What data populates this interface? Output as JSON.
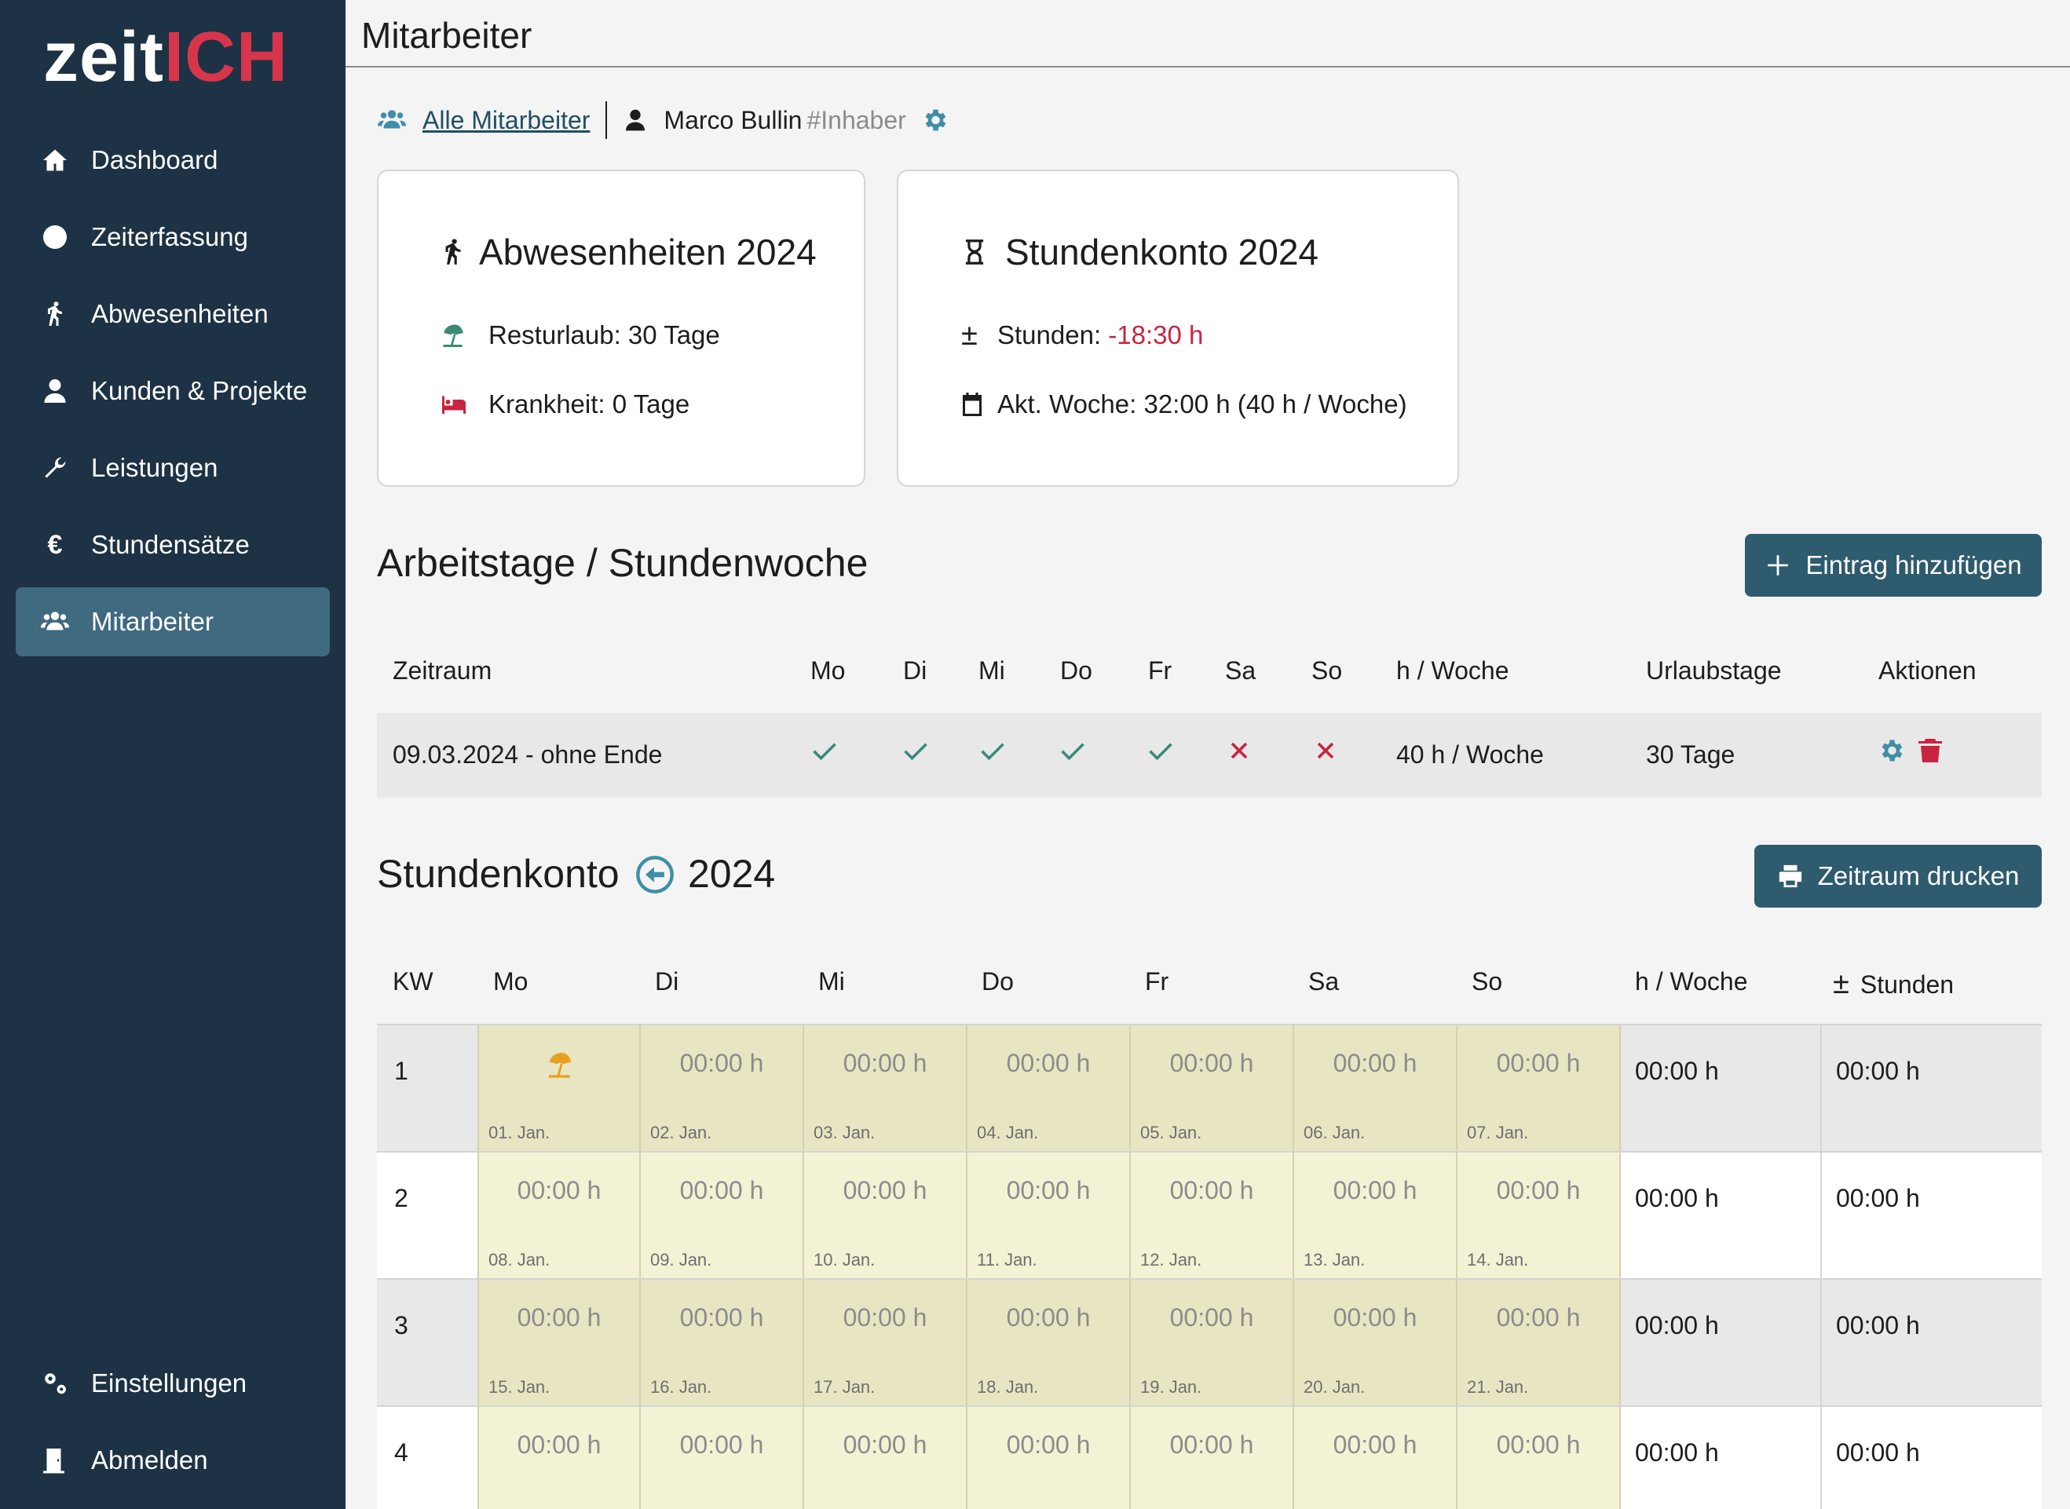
{
  "app": {
    "logo_left": "zeit",
    "logo_right": "ICH"
  },
  "sidebar": {
    "items": [
      {
        "label": "Dashboard",
        "icon": "home-icon"
      },
      {
        "label": "Zeiterfassung",
        "icon": "clock-icon"
      },
      {
        "label": "Abwesenheiten",
        "icon": "walking-icon"
      },
      {
        "label": "Kunden & Projekte",
        "icon": "user-icon"
      },
      {
        "label": "Leistungen",
        "icon": "wrench-icon"
      },
      {
        "label": "Stundensätze",
        "icon": "euro-icon"
      },
      {
        "label": "Mitarbeiter",
        "icon": "users-icon",
        "active": true
      }
    ],
    "bottom": [
      {
        "label": "Einstellungen",
        "icon": "gears-icon"
      },
      {
        "label": "Abmelden",
        "icon": "door-icon"
      }
    ]
  },
  "header": {
    "title": "Mitarbeiter"
  },
  "breadcrumb": {
    "link": "Alle Mitarbeiter",
    "name": "Marco Bullin",
    "role": "#Inhaber"
  },
  "absence_card": {
    "title": "Abwesenheiten 2024",
    "vacation": "Resturlaub: 30 Tage",
    "sick": "Krankheit: 0 Tage"
  },
  "hours_card": {
    "title": "Stundenkonto 2024",
    "hours_label": "Stunden:",
    "hours_value": "-18:30 h",
    "week": "Akt. Woche: 32:00 h (40 h / Woche)"
  },
  "workdays": {
    "title": "Arbeitstage / Stundenwoche",
    "add_button": "Eintrag hinzufügen",
    "headers": [
      "Zeitraum",
      "Mo",
      "Di",
      "Mi",
      "Do",
      "Fr",
      "Sa",
      "So",
      "h / Woche",
      "Urlaubstage",
      "Aktionen"
    ],
    "row": {
      "period": "09.03.2024 - ohne Ende",
      "days": [
        true,
        true,
        true,
        true,
        true,
        false,
        false
      ],
      "hours": "40 h / Woche",
      "vacation": "30 Tage"
    },
    "colors": {
      "check": "#3a8a78",
      "cross": "#c8243f",
      "gear": "#3f8ea8",
      "trash": "#c8243f"
    }
  },
  "account": {
    "title": "Stundenkonto",
    "year": "2024",
    "print_button": "Zeitraum drucken",
    "headers": [
      "KW",
      "Mo",
      "Di",
      "Mi",
      "Do",
      "Fr",
      "Sa",
      "So",
      "h / Woche",
      "Stunden"
    ],
    "rows": [
      {
        "kw": "1",
        "days": [
          {
            "val": "",
            "date": "01. Jan.",
            "holiday": true
          },
          {
            "val": "00:00 h",
            "date": "02. Jan."
          },
          {
            "val": "00:00 h",
            "date": "03. Jan."
          },
          {
            "val": "00:00 h",
            "date": "04. Jan."
          },
          {
            "val": "00:00 h",
            "date": "05. Jan."
          },
          {
            "val": "00:00 h",
            "date": "06. Jan."
          },
          {
            "val": "00:00 h",
            "date": "07. Jan."
          }
        ],
        "week": "00:00 h",
        "hours": "00:00 h"
      },
      {
        "kw": "2",
        "days": [
          {
            "val": "00:00 h",
            "date": "08. Jan."
          },
          {
            "val": "00:00 h",
            "date": "09. Jan."
          },
          {
            "val": "00:00 h",
            "date": "10. Jan."
          },
          {
            "val": "00:00 h",
            "date": "11. Jan."
          },
          {
            "val": "00:00 h",
            "date": "12. Jan."
          },
          {
            "val": "00:00 h",
            "date": "13. Jan."
          },
          {
            "val": "00:00 h",
            "date": "14. Jan."
          }
        ],
        "week": "00:00 h",
        "hours": "00:00 h"
      },
      {
        "kw": "3",
        "days": [
          {
            "val": "00:00 h",
            "date": "15. Jan."
          },
          {
            "val": "00:00 h",
            "date": "16. Jan."
          },
          {
            "val": "00:00 h",
            "date": "17. Jan."
          },
          {
            "val": "00:00 h",
            "date": "18. Jan."
          },
          {
            "val": "00:00 h",
            "date": "19. Jan."
          },
          {
            "val": "00:00 h",
            "date": "20. Jan."
          },
          {
            "val": "00:00 h",
            "date": "21. Jan."
          }
        ],
        "week": "00:00 h",
        "hours": "00:00 h"
      },
      {
        "kw": "4",
        "days": [
          {
            "val": "00:00 h",
            "date": ""
          },
          {
            "val": "00:00 h",
            "date": ""
          },
          {
            "val": "00:00 h",
            "date": ""
          },
          {
            "val": "00:00 h",
            "date": ""
          },
          {
            "val": "00:00 h",
            "date": ""
          },
          {
            "val": "00:00 h",
            "date": ""
          },
          {
            "val": "00:00 h",
            "date": ""
          }
        ],
        "week": "00:00 h",
        "hours": "00:00 h"
      }
    ]
  }
}
